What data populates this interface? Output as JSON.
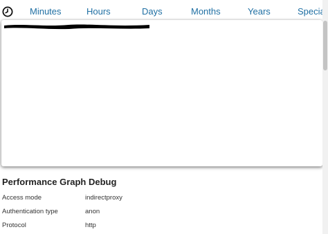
{
  "tabs": [
    {
      "label": "Minutes"
    },
    {
      "label": "Hours"
    },
    {
      "label": "Days"
    },
    {
      "label": "Months"
    },
    {
      "label": "Years"
    },
    {
      "label": "Specia"
    }
  ],
  "colors": {
    "tab_text": "#1f6fa3",
    "redaction": "#000000"
  },
  "icons": {
    "time_range": "clock-icon"
  },
  "debug": {
    "title": "Performance Graph Debug",
    "rows": [
      {
        "key": "Access mode",
        "value": "indirectproxy"
      },
      {
        "key": "Authentication type",
        "value": "anon"
      },
      {
        "key": "Protocol",
        "value": "http"
      }
    ]
  }
}
